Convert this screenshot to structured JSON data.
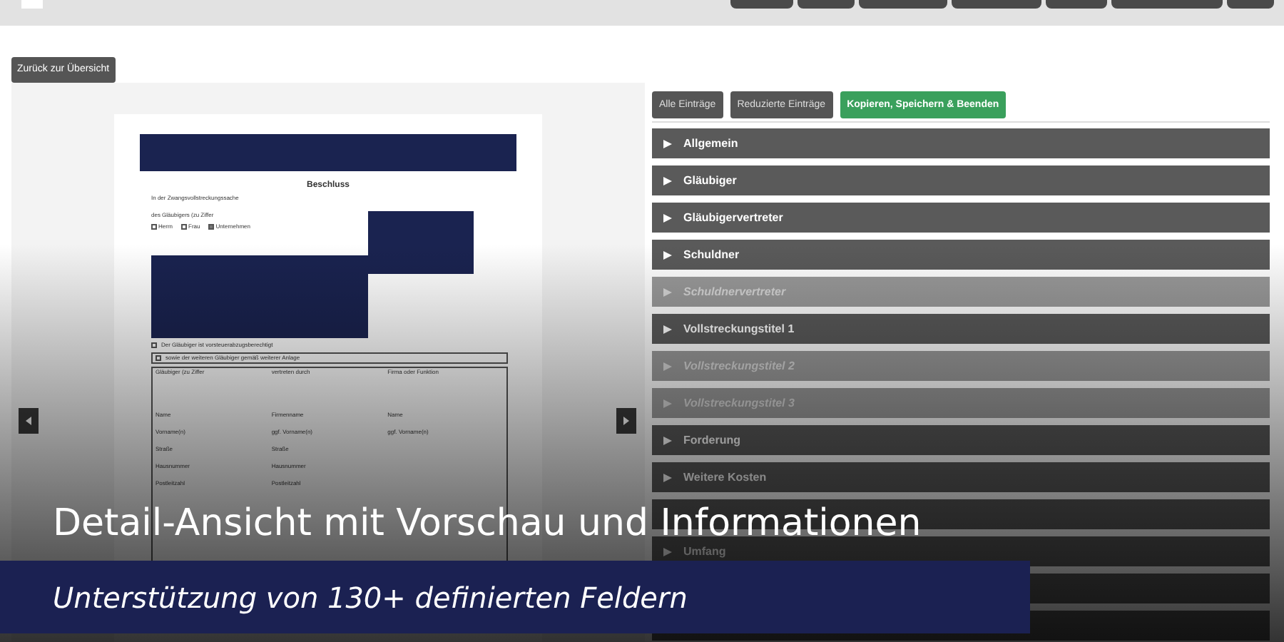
{
  "back_button": "Zurück zur Übersicht",
  "document": {
    "title": "Beschluss",
    "subtitle": "In der Zwangsvollstreckungssache",
    "creditor_line": "des Gläubigers (zu Ziffer",
    "options": [
      {
        "label": "Herrn",
        "checked": false
      },
      {
        "label": "Frau",
        "checked": false
      },
      {
        "label": "Unternehmen",
        "checked": true
      }
    ],
    "notes": [
      {
        "label": "Der Gläubiger ist vorsteuerabzugsberechtigt",
        "checked": false
      },
      {
        "label": "sowie der weiteren Gläubiger gemäß weiterer Anlage",
        "checked": false
      }
    ],
    "columns": [
      {
        "heading": "Gläubiger (zu Ziffer",
        "fields": [
          "Name",
          "Vorname(n)",
          "Straße",
          "Hausnummer",
          "Postleitzahl"
        ]
      },
      {
        "heading": "vertreten durch",
        "fields": [
          "Firmenname",
          "ggf. Vorname(n)",
          "Straße",
          "Hausnummer",
          "Postleitzahl"
        ]
      },
      {
        "heading": "Firma oder Funktion",
        "fields": [
          "Name",
          "ggf. Vorname(n)"
        ]
      }
    ]
  },
  "tabs": [
    {
      "label": "Alle Einträge",
      "kind": "plain"
    },
    {
      "label": "Reduzierte Einträge",
      "kind": "plain"
    },
    {
      "label": "Kopieren, Speichern & Beenden",
      "kind": "primary"
    }
  ],
  "sections": [
    {
      "label": "Allgemein",
      "disabled": false
    },
    {
      "label": "Gläubiger",
      "disabled": false
    },
    {
      "label": "Gläubigervertreter",
      "disabled": false
    },
    {
      "label": "Schuldner",
      "disabled": false
    },
    {
      "label": "Schuldnervertreter",
      "disabled": true
    },
    {
      "label": "Vollstreckungstitel 1",
      "disabled": false
    },
    {
      "label": "Vollstreckungstitel 2",
      "disabled": true
    },
    {
      "label": "Vollstreckungstitel 3",
      "disabled": true
    },
    {
      "label": "Forderung",
      "disabled": false
    },
    {
      "label": "Weitere Kosten",
      "disabled": false
    },
    {
      "disabled": false
    },
    {
      "label": "Umfang",
      "disabled": false
    },
    {
      "disabled": false
    },
    {
      "disabled": false
    }
  ],
  "caption": {
    "title": "Detail-Ansicht mit Vorschau und Informationen",
    "subtitle": "Unterstützung von 130+ definierten Feldern"
  }
}
